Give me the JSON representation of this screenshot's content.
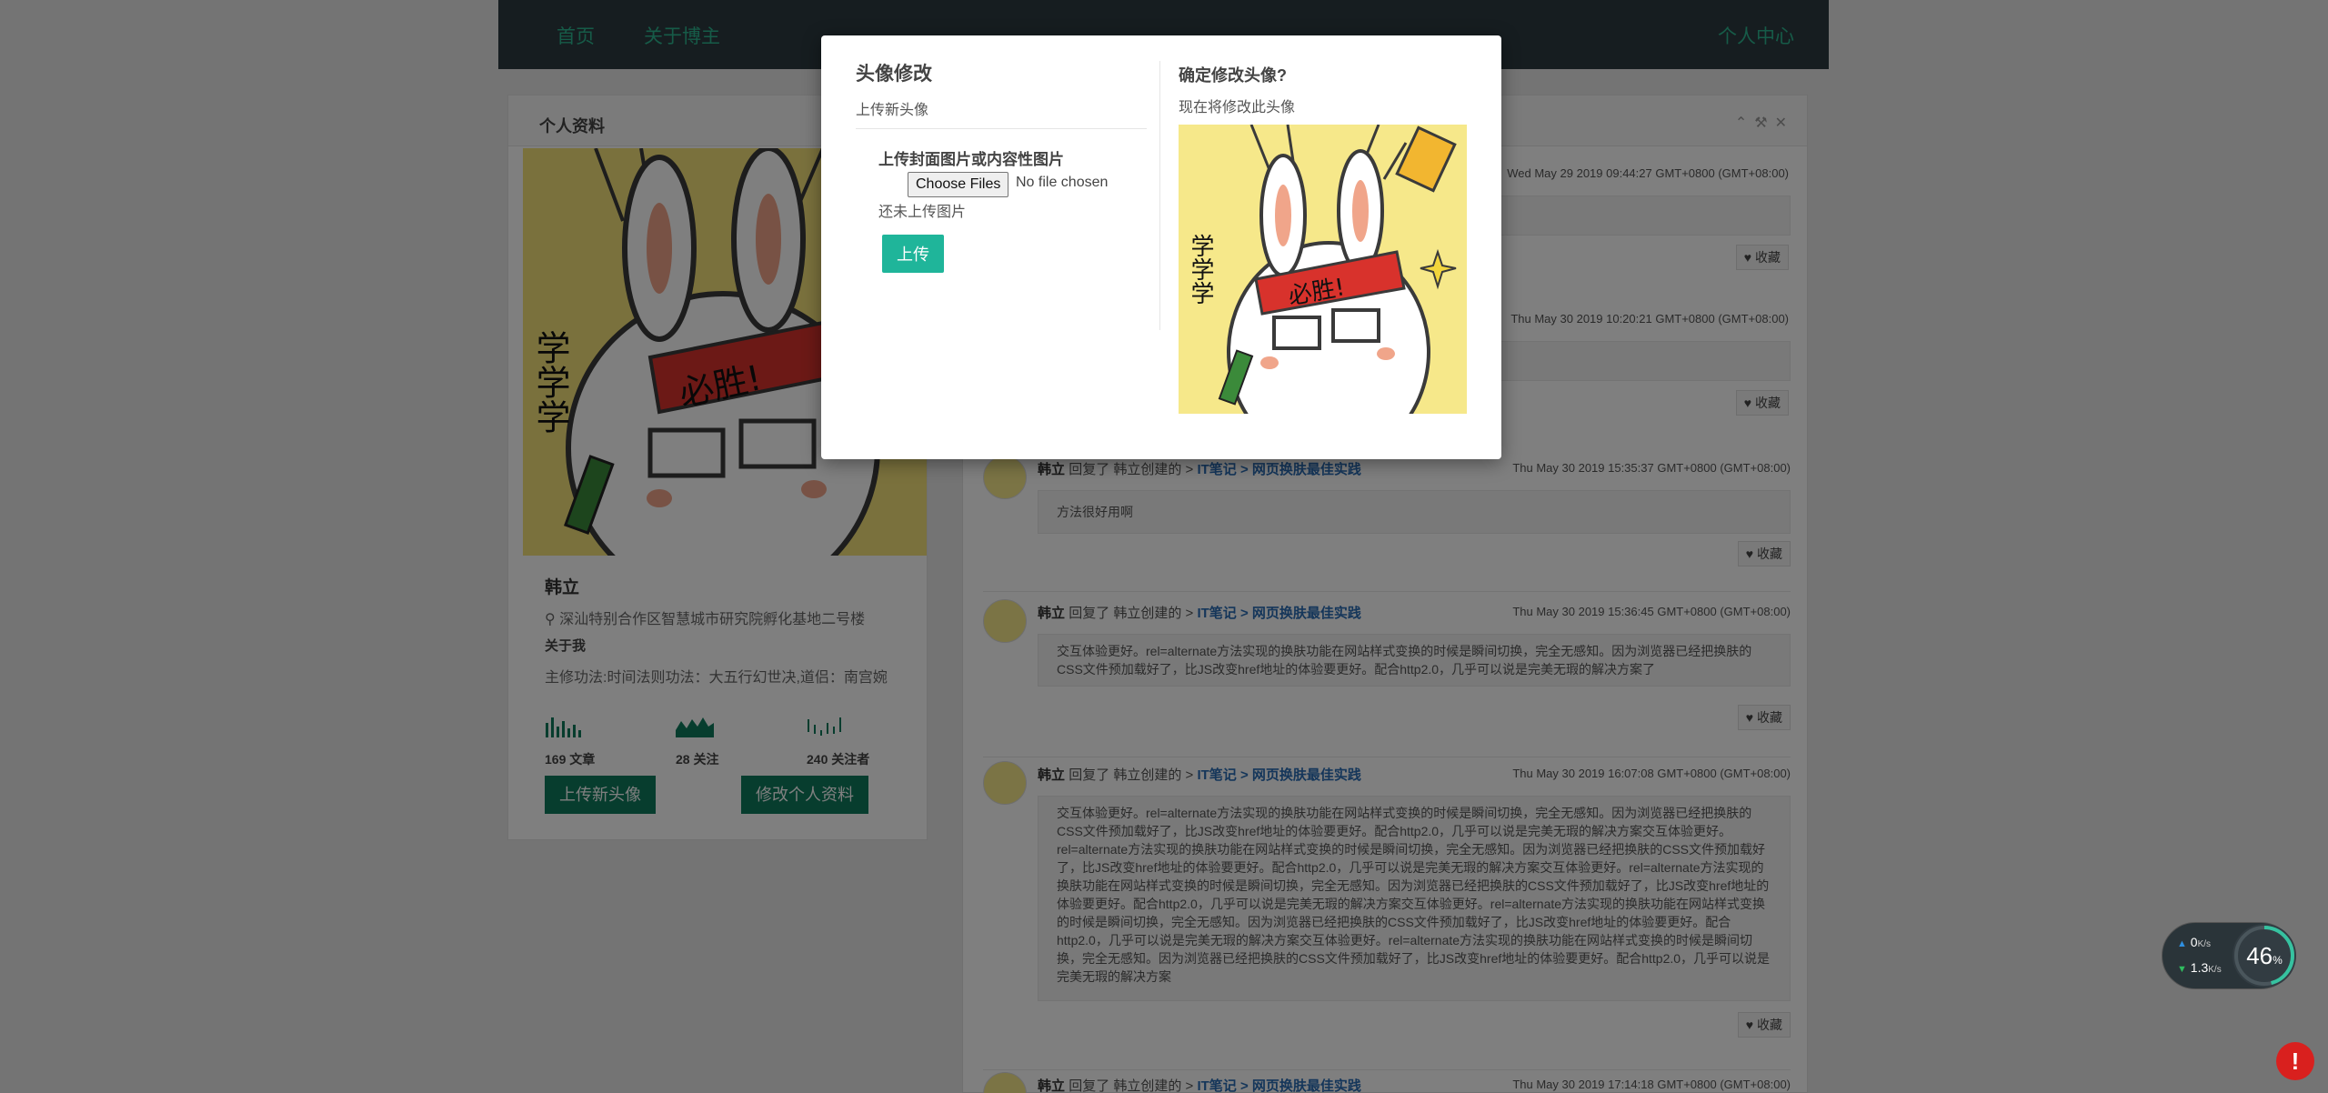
{
  "nav": {
    "home": "首页",
    "about": "关于博主",
    "user_center": "个人中心"
  },
  "profile": {
    "panel_title": "个人资料",
    "name": "韩立",
    "location": "深汕特别合作区智慧城市研究院孵化基地二号楼",
    "about_heading": "关于我",
    "about_text": "主修功法:时间法则功法：大五行幻世决,道侣：南宫婉",
    "stats": [
      {
        "label": "169 文章"
      },
      {
        "label": "28 关注"
      },
      {
        "label": "240 关注者"
      }
    ],
    "upload_avatar_label": "上传新头像",
    "edit_profile_label": "修改个人资料",
    "image_caption": "必胜!",
    "image_side_text": "学学学"
  },
  "feed": {
    "visible_times": [
      "Wed May 29 2019 09:44:27 GMT+0800 (GMT+08:00)",
      "Thu May 30 2019 10:20:21 GMT+0800 (GMT+08:00)"
    ],
    "items": [
      {
        "who": "韩立",
        "action": "回复了 韩立创建的 >",
        "category": "IT笔记",
        "sep": ">",
        "article": "网页换肤最佳实践",
        "time": "Thu May 30 2019 15:35:37 GMT+0800 (GMT+08:00)",
        "body": "方法很好用啊"
      },
      {
        "who": "韩立",
        "action": "回复了 韩立创建的 >",
        "category": "IT笔记",
        "sep": ">",
        "article": "网页换肤最佳实践",
        "time": "Thu May 30 2019 15:36:45 GMT+0800 (GMT+08:00)",
        "body": "交互体验更好。rel=alternate方法实现的换肤功能在网站样式变换的时候是瞬间切换，完全无感知。因为浏览器已经把换肤的CSS文件预加载好了，比JS改变href地址的体验要更好。配合http2.0，几乎可以说是完美无瑕的解决方案了"
      },
      {
        "who": "韩立",
        "action": "回复了 韩立创建的 >",
        "category": "IT笔记",
        "sep": ">",
        "article": "网页换肤最佳实践",
        "time": "Thu May 30 2019 16:07:08 GMT+0800 (GMT+08:00)",
        "body": "交互体验更好。rel=alternate方法实现的换肤功能在网站样式变换的时候是瞬间切换，完全无感知。因为浏览器已经把换肤的CSS文件预加载好了，比JS改变href地址的体验要更好。配合http2.0，几乎可以说是完美无瑕的解决方案交互体验更好。rel=alternate方法实现的换肤功能在网站样式变换的时候是瞬间切换，完全无感知。因为浏览器已经把换肤的CSS文件预加载好了，比JS改变href地址的体验要更好。配合http2.0，几乎可以说是完美无瑕的解决方案交互体验更好。rel=alternate方法实现的换肤功能在网站样式变换的时候是瞬间切换，完全无感知。因为浏览器已经把换肤的CSS文件预加载好了，比JS改变href地址的体验要更好。配合http2.0，几乎可以说是完美无瑕的解决方案交互体验更好。rel=alternate方法实现的换肤功能在网站样式变换的时候是瞬间切换，完全无感知。因为浏览器已经把换肤的CSS文件预加载好了，比JS改变href地址的体验要更好。配合http2.0，几乎可以说是完美无瑕的解决方案交互体验更好。rel=alternate方法实现的换肤功能在网站样式变换的时候是瞬间切换，完全无感知。因为浏览器已经把换肤的CSS文件预加载好了，比JS改变href地址的体验要更好。配合http2.0，几乎可以说是完美无瑕的解决方案"
      },
      {
        "who": "韩立",
        "action": "回复了 韩立创建的 >",
        "category": "IT笔记",
        "sep": ">",
        "article": "网页换肤最佳实践",
        "time": "Thu May 30 2019 17:14:18 GMT+0800 (GMT+08:00)",
        "body": ""
      }
    ],
    "fav_label": "收藏"
  },
  "modal": {
    "title": "头像修改",
    "subtitle": "上传新头像",
    "upload_heading": "上传封面图片或内容性图片",
    "file_button": "Choose Files",
    "file_status": "No file chosen",
    "not_uploaded": "还未上传图片",
    "upload_button": "上传",
    "confirm_heading": "确定修改头像?",
    "confirm_sub": "现在将修改此头像"
  },
  "speed_widget": {
    "up": "0",
    "down": "1.3",
    "unit": "K/s",
    "percent": "46",
    "percent_unit": "%"
  },
  "alert": {
    "symbol": "!"
  },
  "icons": {
    "location": "map-marker-icon",
    "favorite": "heart-icon",
    "panel_tools": [
      "chevron-up-icon",
      "wrench-icon",
      "close-icon"
    ]
  },
  "colors": {
    "accent": "#0e7a5d",
    "nav_link": "#2db790",
    "upload_button": "#1fb59a",
    "alert": "#d9201e"
  }
}
